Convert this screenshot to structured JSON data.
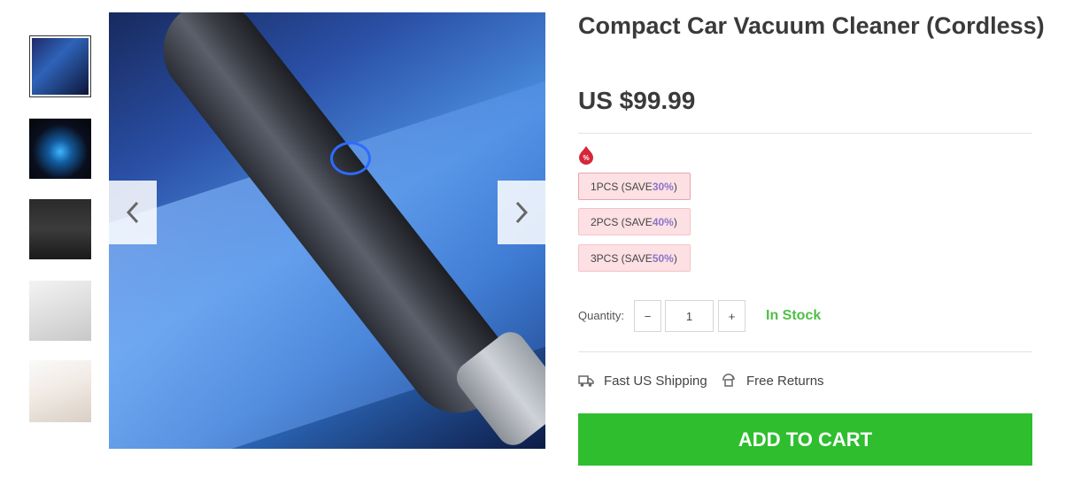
{
  "product": {
    "title": "Compact Car Vacuum Cleaner (Cordless)",
    "price": "US $99.99"
  },
  "gallery": {
    "thumbnails": [
      {
        "name": "vacuum-blue-photo",
        "active": true
      },
      {
        "name": "motor-photo",
        "active": false
      },
      {
        "name": "vacuum-pair-photo",
        "active": false
      },
      {
        "name": "car-seat-cleaning-photo",
        "active": false
      },
      {
        "name": "hand-held-photo",
        "active": false
      }
    ],
    "prev_icon": "chevron-left-icon",
    "next_icon": "chevron-right-icon"
  },
  "bundles": [
    {
      "label_prefix": "1PCS (SAVE ",
      "percent": "30%",
      "suffix": ")"
    },
    {
      "label_prefix": "2PCS (SAVE ",
      "percent": "40%",
      "suffix": ")"
    },
    {
      "label_prefix": "3PCS (SAVE ",
      "percent": "50%",
      "suffix": ")"
    }
  ],
  "quantity": {
    "label": "Quantity:",
    "minus": "−",
    "plus": "+",
    "value": "1"
  },
  "stock": "In Stock",
  "features": [
    {
      "icon": "truck-icon",
      "label": "Fast US Shipping"
    },
    {
      "icon": "returns-icon",
      "label": "Free Returns"
    }
  ],
  "cart": {
    "label": "ADD TO CART"
  },
  "colors": {
    "accent_green": "#2ebe2e",
    "stock_green": "#4fbf45",
    "bundle_bg": "#fde0e3",
    "bundle_percent": "#8d74c9"
  }
}
